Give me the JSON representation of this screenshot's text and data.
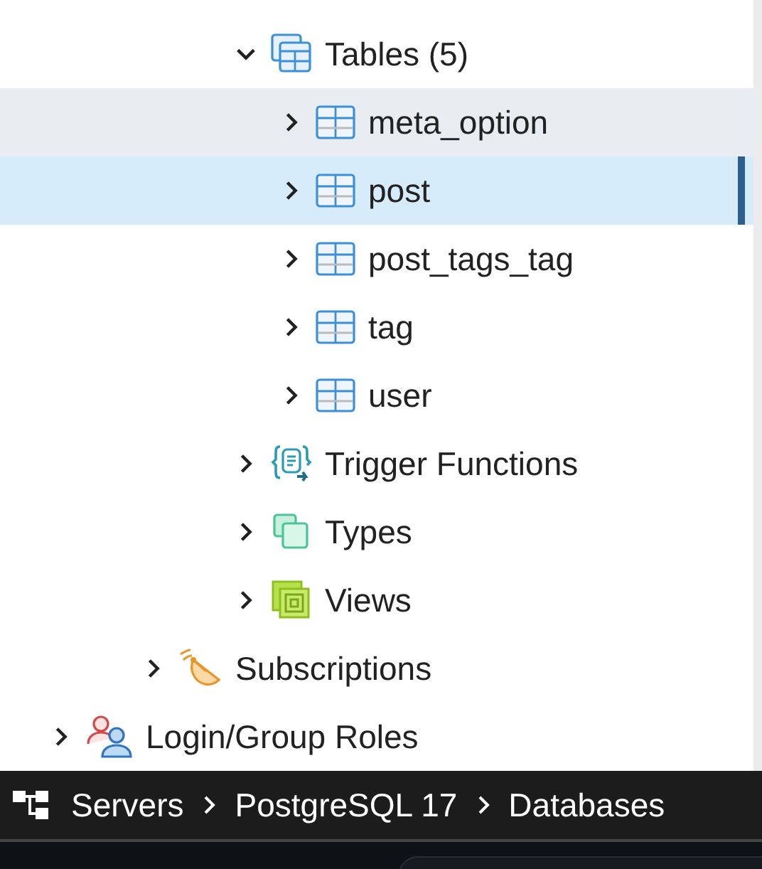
{
  "tree": [
    {
      "children": [
        {
          "children": [
            {
              "children": [
                {
                  "children": [
                    {
                      "label": "Tables (5)",
                      "kind": "tables",
                      "expanded": true,
                      "selected": false,
                      "hovered": false,
                      "children": [
                        {
                          "label": "meta_option",
                          "kind": "table",
                          "expanded": false,
                          "selected": false,
                          "hovered": true
                        },
                        {
                          "label": "post",
                          "kind": "table",
                          "expanded": false,
                          "selected": true,
                          "hovered": false
                        },
                        {
                          "label": "post_tags_tag",
                          "kind": "table",
                          "expanded": false,
                          "selected": false,
                          "hovered": false
                        },
                        {
                          "label": "tag",
                          "kind": "table",
                          "expanded": false,
                          "selected": false,
                          "hovered": false
                        },
                        {
                          "label": "user",
                          "kind": "table",
                          "expanded": false,
                          "selected": false,
                          "hovered": false
                        }
                      ]
                    },
                    {
                      "label": "Trigger Functions",
                      "kind": "trigger-functions",
                      "expanded": false,
                      "selected": false,
                      "hovered": false
                    },
                    {
                      "label": "Types",
                      "kind": "types",
                      "expanded": false,
                      "selected": false,
                      "hovered": false
                    },
                    {
                      "label": "Views",
                      "kind": "views",
                      "expanded": false,
                      "selected": false,
                      "hovered": false
                    }
                  ]
                }
              ]
            },
            {
              "label": "Subscriptions",
              "kind": "subscriptions",
              "expanded": false,
              "selected": false,
              "hovered": false
            }
          ]
        }
      ]
    },
    {
      "label": "Login/Group Roles",
      "kind": "roles",
      "expanded": false,
      "selected": false,
      "hovered": false
    }
  ],
  "breadcrumb": [
    {
      "label": "Servers"
    },
    {
      "label": "PostgreSQL 17"
    },
    {
      "label": "Databases"
    }
  ]
}
